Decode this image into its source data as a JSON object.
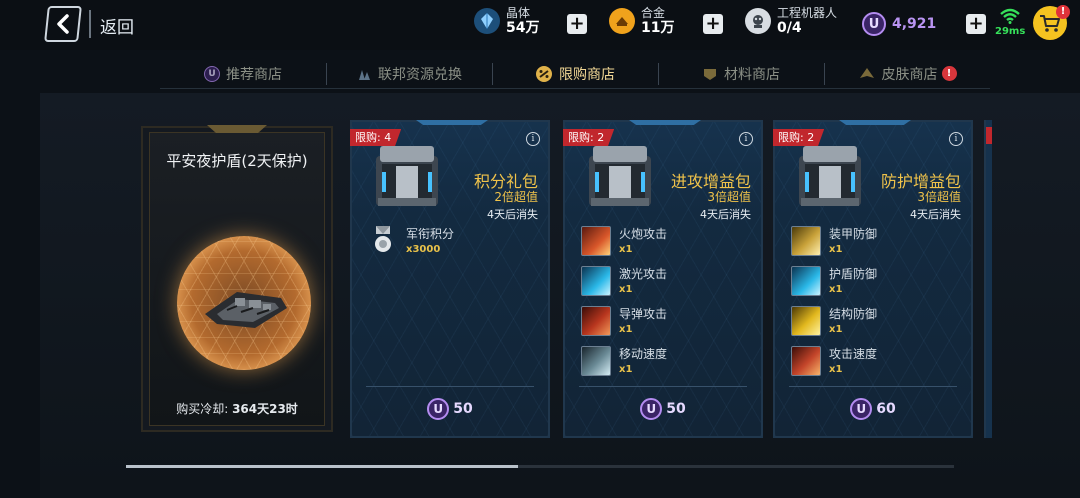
{
  "topbar": {
    "back_label": "返回",
    "resources": [
      {
        "name": "晶体",
        "value": "54万",
        "icon": "crystal-icon",
        "color": "#6ab8f0"
      },
      {
        "name": "合金",
        "value": "11万",
        "icon": "alloy-icon",
        "color": "#f0a21c"
      },
      {
        "name": "工程机器人",
        "value": "0/4",
        "icon": "robot-icon",
        "color": "#d8dde2"
      }
    ],
    "premium_currency": {
      "symbol": "U",
      "value": "4,921",
      "color": "#b48cf0"
    },
    "plus_symbol": "+",
    "ping": "29ms",
    "cart_badge": "!"
  },
  "tabs": [
    {
      "label": "推荐商店",
      "icon": "u-coin-icon"
    },
    {
      "label": "联邦资源兑换",
      "icon": "crystal-icon"
    },
    {
      "label": "限购商店",
      "icon": "discount-icon",
      "active": true
    },
    {
      "label": "材料商店",
      "icon": "badge-icon"
    },
    {
      "label": "皮肤商店",
      "icon": "ship-icon",
      "badge": "!"
    }
  ],
  "shield": {
    "title": "平安夜护盾(2天保护)",
    "cooldown_label": "购买冷却:",
    "cooldown_value": "364天23时"
  },
  "packs": [
    {
      "limit": "限购: 4",
      "title": "积分礼包",
      "multiplier": "2倍超值",
      "expire": "4天后消失",
      "items": [
        {
          "name": "军衔积分",
          "qty": "x3000",
          "icon": "medal-icon"
        }
      ],
      "price_symbol": "U",
      "price": "50"
    },
    {
      "limit": "限购: 2",
      "title": "进攻增益包",
      "multiplier": "3倍超值",
      "expire": "4天后消失",
      "items": [
        {
          "name": "火炮攻击",
          "qty": "x1",
          "icon": "cannon-icon"
        },
        {
          "name": "激光攻击",
          "qty": "x1",
          "icon": "laser-icon"
        },
        {
          "name": "导弹攻击",
          "qty": "x1",
          "icon": "missile-icon"
        },
        {
          "name": "移动速度",
          "qty": "x1",
          "icon": "speed-icon"
        }
      ],
      "price_symbol": "U",
      "price": "50"
    },
    {
      "limit": "限购: 2",
      "title": "防护增益包",
      "multiplier": "3倍超值",
      "expire": "4天后消失",
      "items": [
        {
          "name": "装甲防御",
          "qty": "x1",
          "icon": "armor-icon"
        },
        {
          "name": "护盾防御",
          "qty": "x1",
          "icon": "shield-defense-icon"
        },
        {
          "name": "结构防御",
          "qty": "x1",
          "icon": "structure-icon"
        },
        {
          "name": "攻击速度",
          "qty": "x1",
          "icon": "attack-speed-icon"
        }
      ],
      "price_symbol": "U",
      "price": "60"
    }
  ]
}
